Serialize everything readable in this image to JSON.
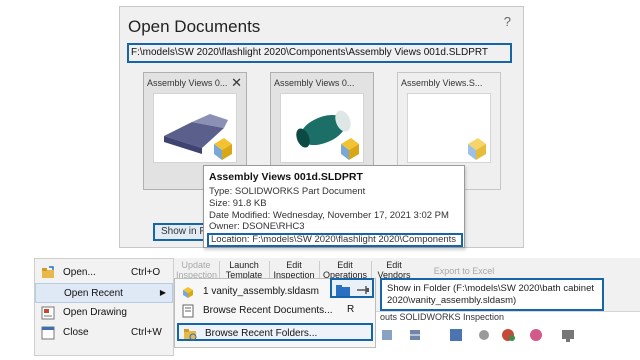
{
  "dialog": {
    "title": "Open Documents",
    "help": "?",
    "path": "F:\\models\\SW 2020\\flashlight 2020\\Components\\Assembly Views 001d.SLDPRT",
    "cards": [
      {
        "label": "Assembly Views 0...",
        "close": "✕"
      },
      {
        "label": "Assembly Views 0..."
      },
      {
        "label": "Assembly Views.S..."
      }
    ],
    "show_in_folder": "Show in Folder"
  },
  "tooltip": {
    "title": "Assembly Views 001d.SLDPRT",
    "type": "Type: SOLIDWORKS Part Document",
    "size": "Size: 91.8 KB",
    "modified": "Date Modified: Wednesday, November 17, 2021 3:02 PM",
    "owner": "Owner: DSONE\\RHC3",
    "location": "Location: F:\\models\\SW 2020\\flashlight 2020\\Components"
  },
  "file_menu": {
    "items": [
      {
        "label": "Open...",
        "shortcut": "Ctrl+O",
        "icon": "open-folder-icon"
      },
      {
        "label": "Open Recent",
        "arrow": "▶",
        "icon": "none"
      },
      {
        "label": "Open Drawing",
        "icon": "drawing-icon"
      },
      {
        "label": "Close",
        "shortcut": "Ctrl+W",
        "icon": "close-doc-icon"
      }
    ]
  },
  "ribbon": {
    "buttons": [
      "Update\nInspection",
      "Launch\nTemplate",
      "Edit\nInspection",
      "Edit\nOperations",
      "Edit\nVendors",
      "Export to Excel"
    ],
    "tab_strip": "outs    SOLIDWORKS Inspection"
  },
  "recent_submenu": {
    "items": [
      {
        "label": "1 vanity_assembly.sldasm",
        "icon": "assembly-icon"
      },
      {
        "label": "Browse Recent Documents...",
        "icon": "browse-docs-icon"
      },
      {
        "label": "Browse Recent Folders...",
        "icon": "browse-folders-icon"
      }
    ],
    "key_r": "R"
  },
  "folder_tooltip": {
    "text": "Show in Folder (F:\\models\\SW 2020\\bath cabinet 2020\\vanity_assembly.sldasm)"
  },
  "colors": {
    "highlight_border": "#1565a8"
  }
}
